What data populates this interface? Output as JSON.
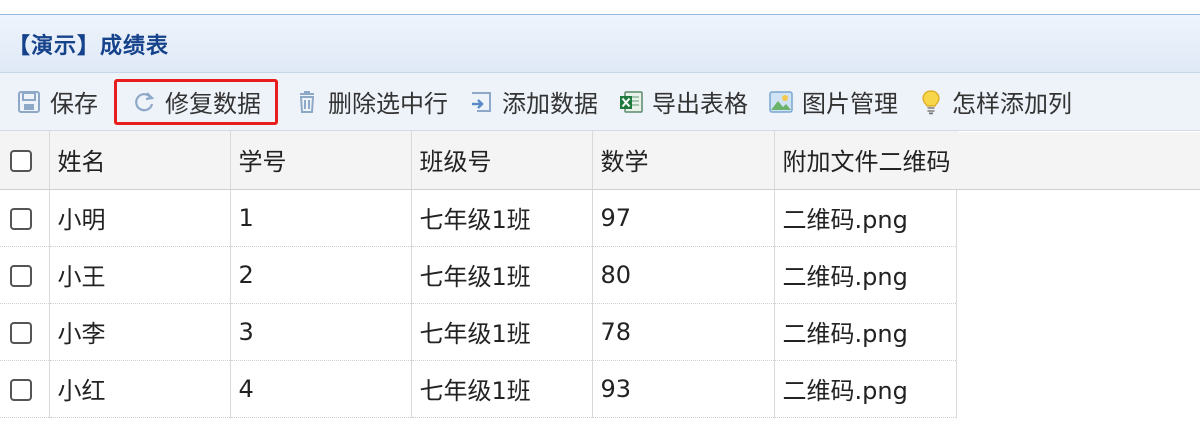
{
  "panel": {
    "title": "【演示】成绩表"
  },
  "toolbar": {
    "buttons": [
      {
        "label": "保存",
        "icon": "save-icon"
      },
      {
        "label": "修复数据",
        "icon": "refresh-icon",
        "highlighted": true
      },
      {
        "label": "删除选中行",
        "icon": "trash-icon"
      },
      {
        "label": "添加数据",
        "icon": "add-data-icon"
      },
      {
        "label": "导出表格",
        "icon": "excel-icon"
      },
      {
        "label": "图片管理",
        "icon": "image-icon"
      },
      {
        "label": "怎样添加列",
        "icon": "lightbulb-icon"
      }
    ],
    "highlight_color": "#e81e1e"
  },
  "grid": {
    "columns": [
      "姓名",
      "学号",
      "班级号",
      "数学",
      "附加文件二维码"
    ],
    "rows": [
      {
        "name": "小明",
        "id": "1",
        "class": "七年级1班",
        "math": "97",
        "file": "二维码.png"
      },
      {
        "name": "小王",
        "id": "2",
        "class": "七年级1班",
        "math": "80",
        "file": "二维码.png"
      },
      {
        "name": "小李",
        "id": "3",
        "class": "七年级1班",
        "math": "78",
        "file": "二维码.png"
      },
      {
        "name": "小红",
        "id": "4",
        "class": "七年级1班",
        "math": "93",
        "file": "二维码.png"
      }
    ]
  },
  "colors": {
    "title": "#15428b",
    "header_bg": "#dfe9f6",
    "toolbar_bg": "#eef3f9"
  }
}
